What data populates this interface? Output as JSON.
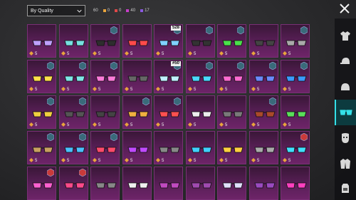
{
  "filter": {
    "label": "By Quality"
  },
  "counts": [
    {
      "value": "60",
      "color": "#9a9a9a"
    },
    {
      "value": "0",
      "color": "#e8a43c"
    },
    {
      "value": "0",
      "color": "#e04848"
    },
    {
      "value": "40",
      "color": "#c83ec8"
    },
    {
      "value": "17",
      "color": "#8a5ae0"
    }
  ],
  "tags": {
    "row1_col4": "528",
    "row2_col4": "#50"
  },
  "quantity": "5",
  "sidebar": [
    {
      "name": "outfit-icon"
    },
    {
      "name": "cap-icon"
    },
    {
      "name": "helmet-icon"
    },
    {
      "name": "eyewear-icon",
      "active": true
    },
    {
      "name": "mask-icon"
    },
    {
      "name": "jacket-icon"
    },
    {
      "name": "backpack-icon"
    }
  ],
  "colors": {
    "accent": "#34e0e8",
    "cell": "#5a1f58"
  }
}
